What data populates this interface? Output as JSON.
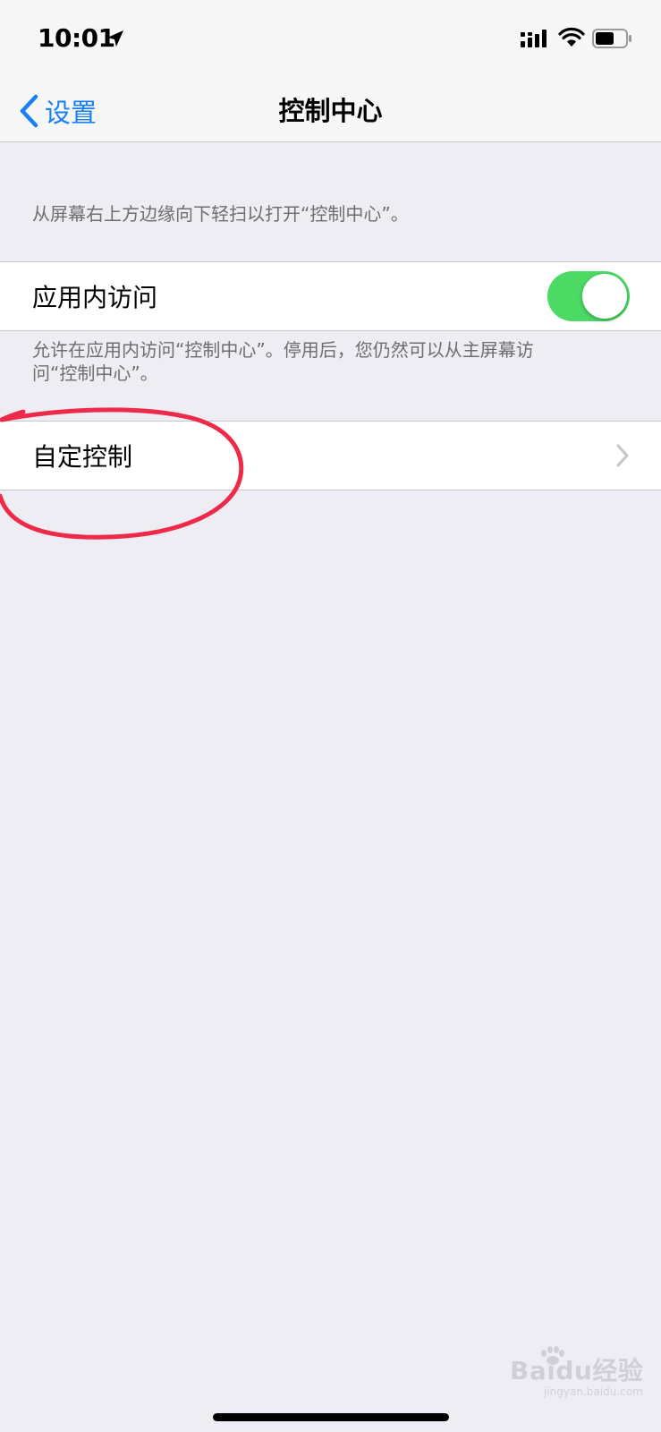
{
  "status_bar": {
    "time": "10:01",
    "icons": [
      "location-arrow-icon",
      "cellular-signal-icon",
      "wifi-icon",
      "battery-icon"
    ]
  },
  "nav": {
    "back_label": "设置",
    "title": "控制中心"
  },
  "sections": {
    "intro_note": "从屏幕右上方边缘向下轻扫以打开“控制中心”。",
    "in_app_access": {
      "label": "应用内访问",
      "toggle_on": true,
      "footer": "允许在应用内访问“控制中心”。停用后，您仍然可以从主屏幕访问“控制中心”。"
    },
    "customize": {
      "label": "自定控制"
    }
  },
  "watermark": {
    "main": "Baidu经验",
    "sub": "jingyan.baidu.com"
  },
  "colors": {
    "accent": "#1a7ff5",
    "toggle_on": "#4cd964",
    "background": "#efedf4",
    "annotation": "#ee2a4a"
  }
}
